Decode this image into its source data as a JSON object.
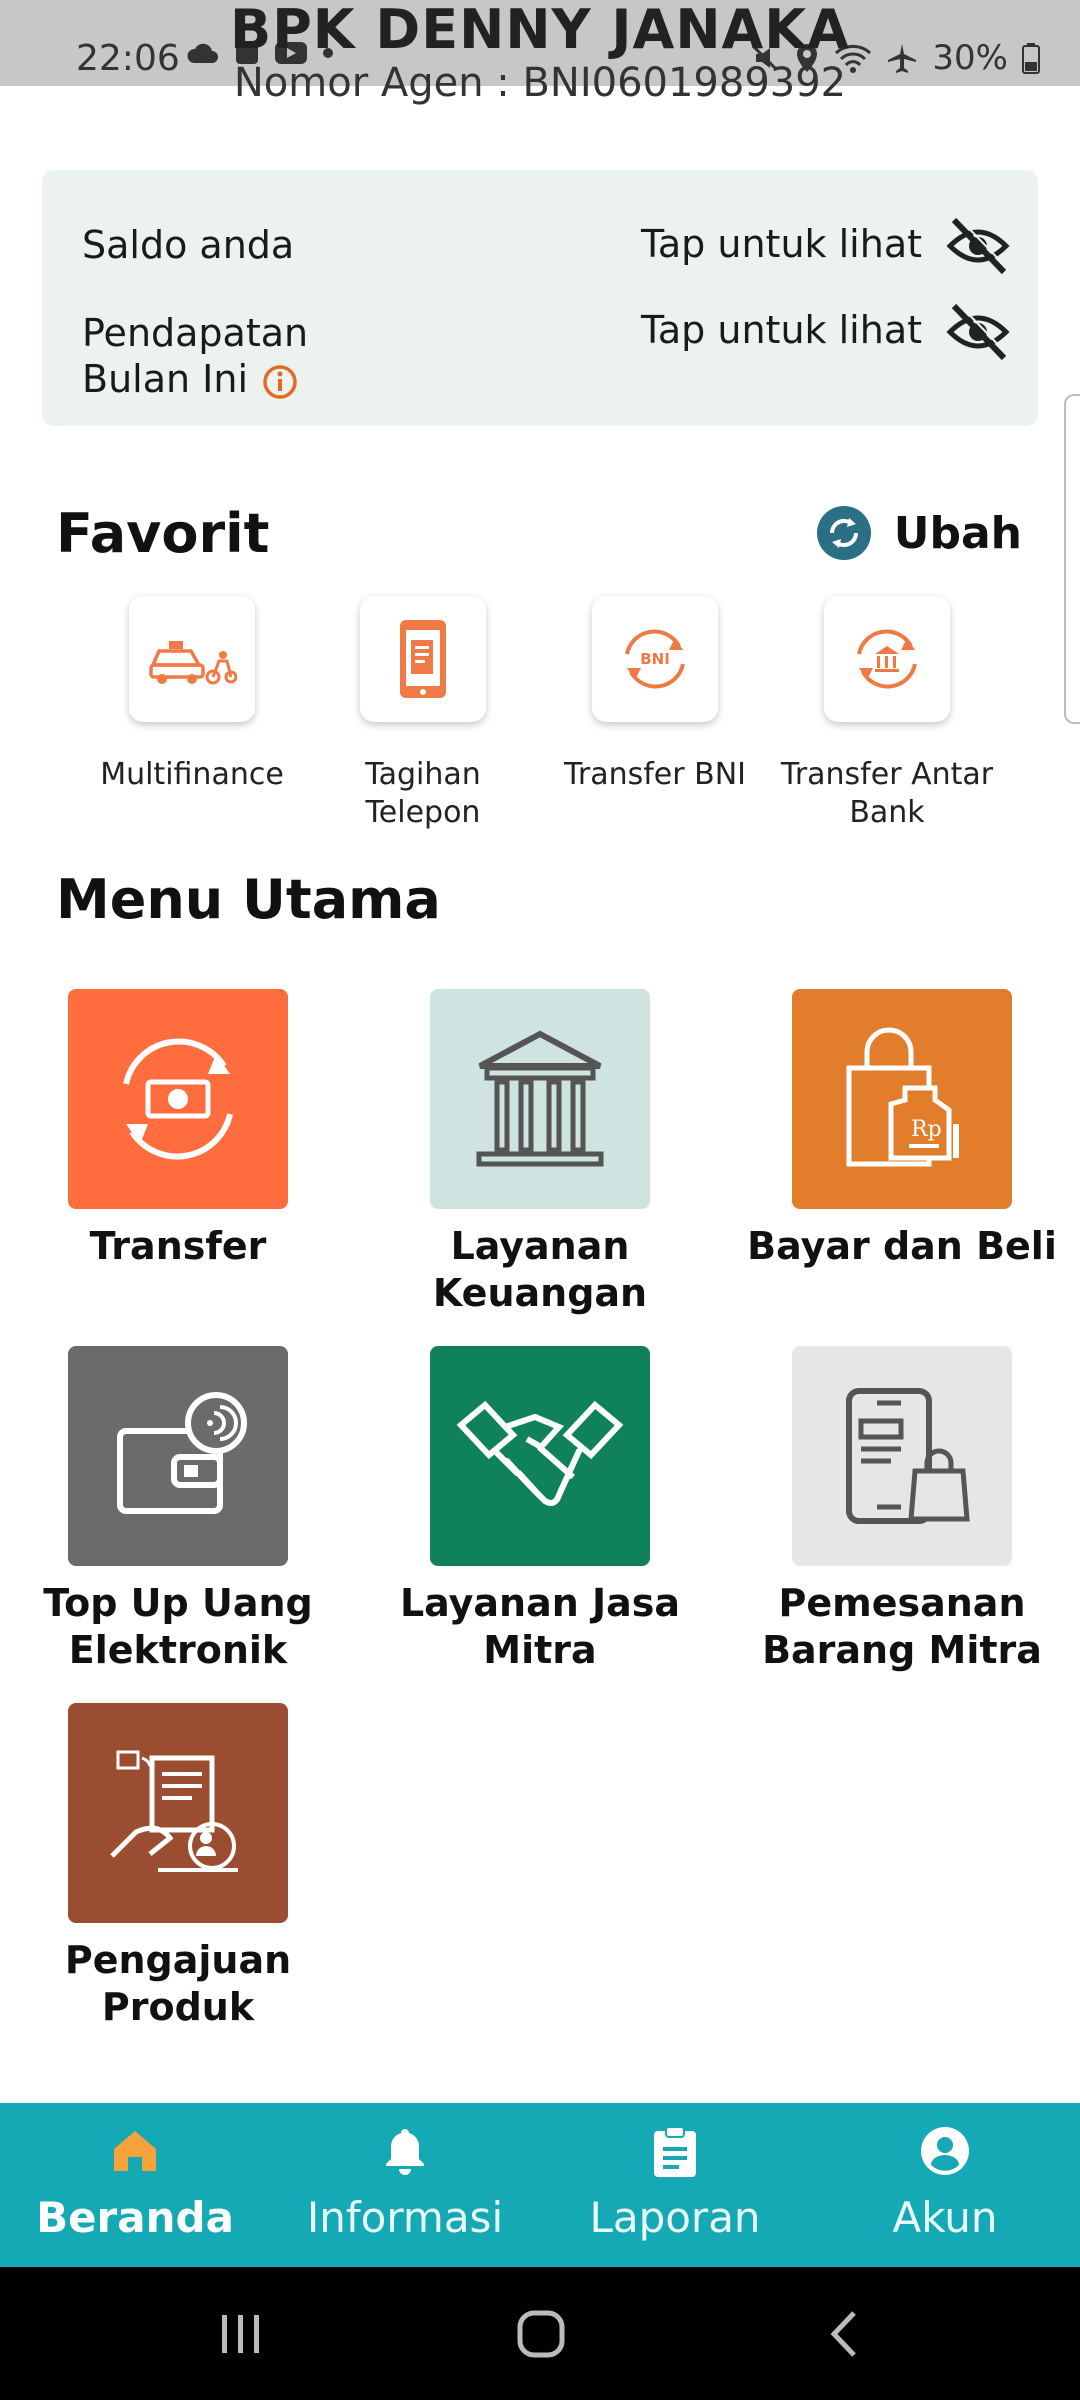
{
  "status_bar": {
    "time": "22:06",
    "battery": "30%"
  },
  "header": {
    "name": "BPK DENNY JANAKA",
    "agent": "Nomor Agen : BNI0601989392"
  },
  "balance": {
    "saldo_label": "Saldo anda",
    "saldo_action": "Tap untuk lihat",
    "pendapatan_label_line1": "Pendapatan",
    "pendapatan_label_line2": "Bulan Ini",
    "pendapatan_action": "Tap untuk lihat"
  },
  "favorit": {
    "title": "Favorit",
    "edit_label": "Ubah",
    "items": [
      {
        "label": "Multifinance",
        "icon": "car-motorcycle-icon"
      },
      {
        "label": "Tagihan Telepon",
        "icon": "phone-bill-icon"
      },
      {
        "label": "Transfer BNI",
        "icon": "transfer-bni-icon"
      },
      {
        "label": "Transfer Antar Bank",
        "icon": "transfer-bank-icon"
      }
    ]
  },
  "menu": {
    "title": "Menu Utama",
    "items": [
      {
        "label": "Transfer",
        "color": "#ff6d3f",
        "icon": "money-transfer-icon"
      },
      {
        "label": "Layanan Keuangan",
        "color": "#cfe4e1",
        "icon": "bank-building-icon"
      },
      {
        "label": "Bayar dan Beli",
        "color": "#e27d2c",
        "icon": "shopping-bag-icon"
      },
      {
        "label": "Top Up Uang Elektronik",
        "color": "#6b6b6b",
        "icon": "e-wallet-icon"
      },
      {
        "label": "Layanan Jasa Mitra",
        "color": "#10825a",
        "icon": "handshake-icon"
      },
      {
        "label": "Pemesanan Barang Mitra",
        "color": "#e6e6e6",
        "icon": "phone-order-icon"
      },
      {
        "label": "Pengajuan Produk",
        "color": "#9b4d32",
        "icon": "product-application-icon"
      }
    ]
  },
  "bottom_nav": {
    "items": [
      {
        "label": "Beranda",
        "icon": "home-icon",
        "active": true
      },
      {
        "label": "Informasi",
        "icon": "bell-icon",
        "active": false
      },
      {
        "label": "Laporan",
        "icon": "clipboard-icon",
        "active": false
      },
      {
        "label": "Akun",
        "icon": "account-icon",
        "active": false
      }
    ]
  },
  "colors": {
    "accent": "#14a9b4",
    "active_tab_icon": "#f6a23a",
    "icon_orange": "#f07a45"
  }
}
